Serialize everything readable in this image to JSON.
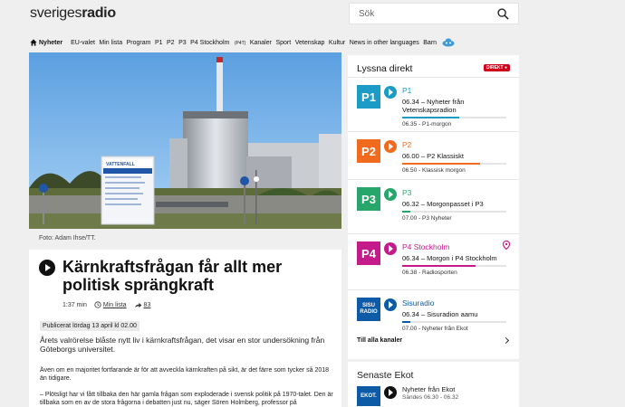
{
  "header": {
    "logo_light": "sveriges",
    "logo_bold": "radio",
    "search_placeholder": "Sök"
  },
  "nav": {
    "items": [
      "Nyheter",
      "EU-valet",
      "Min lista",
      "Program",
      "P1",
      "P2",
      "P3",
      "P4 Stockholm",
      "(P4T)",
      "Kanaler",
      "Sport",
      "Vetenskap",
      "Kultur",
      "News in other languages",
      "Barn"
    ]
  },
  "hero": {
    "sign_text": "VATTENFALL",
    "caption": "Foto: Adam Ihse/TT."
  },
  "article": {
    "title": "Kärnkraftsfrågan får allt mer politisk sprängkraft",
    "duration": "1:37 min",
    "my_list": "Min lista",
    "share_count": "83",
    "published": "Publicerat lördag 13 april kl 02.00",
    "lead": "Årets valrörelse blåste nytt liv i kärnkraftsfrågan, det visar en stor undersökning från Göteborgs universitet.",
    "body1": "Även om en majoritet fortfarande är för att avveckla kärnkraften på sikt, är det färre som tycker så 2018 än tidigare.",
    "body2": "– Plötsligt har vi fått tillbaka den här gamla frågan som exploderade i svensk politik på 1970-talet. Den är tillbaka som en av de stora frågorna i debatten just nu, säger Sören Holmberg, professor på"
  },
  "live": {
    "heading": "Lyssna direkt",
    "badge": "DIREKT",
    "all_channels": "Till alla kanaler",
    "channels": [
      {
        "logo": "P1",
        "name": "P1",
        "time": "06.34",
        "now": "Nyheter från Vetenskapsradion",
        "next": "06.35 - P1-morgon",
        "progress": 0.55,
        "color": "#1d9bc7"
      },
      {
        "logo": "P2",
        "name": "P2",
        "time": "06.00",
        "now": "P2 Klassiskt",
        "next": "06.50 - Klassisk morgon",
        "progress": 0.75,
        "color": "#f26a1d"
      },
      {
        "logo": "P3",
        "name": "P3",
        "time": "06.32",
        "now": "Morgonpasset i P3",
        "next": "07.00 - P3 Nyheter",
        "progress": 0.08,
        "color": "#26a66b"
      },
      {
        "logo": "P4",
        "name": "P4 Stockholm",
        "time": "06.34",
        "now": "Morgon i P4 Stockholm",
        "next": "06.38 - Radiosporten",
        "progress": 0.7,
        "color": "#c31c8a"
      },
      {
        "logo": "SISU RADIO",
        "name": "Sisuradio",
        "time": "06.34",
        "now": "Sisuradion aamu",
        "next": "07.00 - Nyheter från Ekot",
        "progress": 0.08,
        "color": "#0d5aa7"
      }
    ]
  },
  "ekot": {
    "heading": "Senaste Ekot",
    "logo": "EKOT.",
    "title": "Nyheter från Ekot",
    "sub": "Sändes 06.30 - 06.32"
  }
}
